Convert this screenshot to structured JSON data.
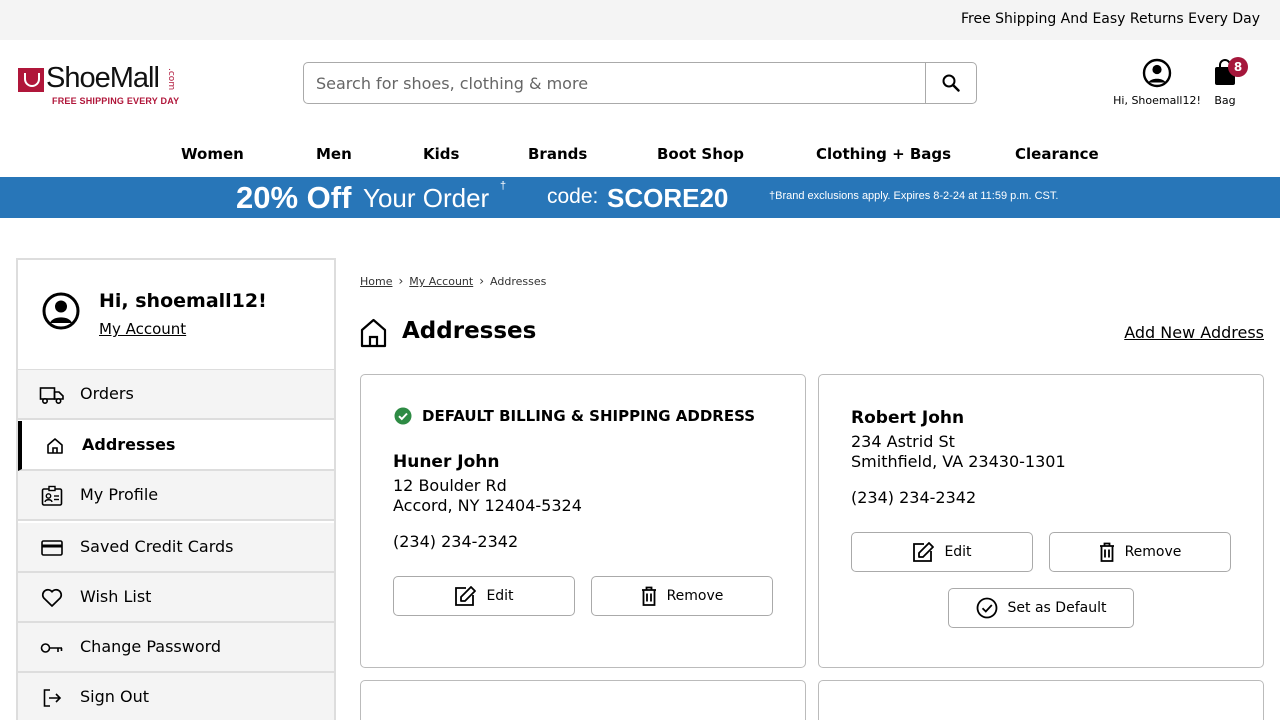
{
  "topbar": {
    "text": "Free Shipping And Easy Returns Every Day"
  },
  "logo": {
    "name": "ShoeMall",
    "com": ".com",
    "tagline": "FREE SHIPPING EVERY DAY"
  },
  "search": {
    "placeholder": "Search for shoes, clothing & more",
    "value": ""
  },
  "account": {
    "label": "Hi, Shoemall12!"
  },
  "bag": {
    "label": "Bag",
    "count": "8"
  },
  "nav": [
    "Women",
    "Men",
    "Kids",
    "Brands",
    "Boot Shop",
    "Clothing + Bags",
    "Clearance"
  ],
  "promo": {
    "big": "20% Off",
    "rest": "Your Order",
    "dagger": "†",
    "code_label": "code:",
    "code": "SCORE20",
    "fine": "†Brand exclusions apply. Expires 8-2-24 at 11:59 p.m. CST."
  },
  "sidebar": {
    "greeting": "Hi, shoemall12!",
    "account_link": "My Account",
    "items": [
      {
        "label": "Orders",
        "icon": "truck-icon"
      },
      {
        "label": "Addresses",
        "icon": "home-icon",
        "active": true
      },
      {
        "label": "My Profile",
        "icon": "id-badge-icon"
      },
      {
        "label": "Saved Credit Cards",
        "icon": "credit-card-icon"
      },
      {
        "label": "Wish List",
        "icon": "heart-icon"
      },
      {
        "label": "Change Password",
        "icon": "key-icon"
      },
      {
        "label": "Sign Out",
        "icon": "sign-out-icon"
      }
    ]
  },
  "breadcrumb": {
    "home": "Home",
    "account": "My Account",
    "current": "Addresses"
  },
  "page": {
    "title": "Addresses",
    "add_new": "Add New Address"
  },
  "addresses": [
    {
      "default_label": "DEFAULT BILLING & SHIPPING ADDRESS",
      "name": "Huner John",
      "line1": "12 Boulder Rd",
      "line2": "Accord, NY 12404-5324",
      "phone": "(234) 234-2342",
      "edit": "Edit",
      "remove": "Remove"
    },
    {
      "name": "Robert John",
      "line1": "234 Astrid St",
      "line2": "Smithfield, VA 23430-1301",
      "phone": "(234) 234-2342",
      "edit": "Edit",
      "remove": "Remove",
      "set_default": "Set as Default"
    }
  ],
  "colors": {
    "brand": "#a5173b",
    "promo_bg": "#2876b8",
    "check_green": "#2e8b44",
    "panel_bg": "#f4f4f4"
  }
}
